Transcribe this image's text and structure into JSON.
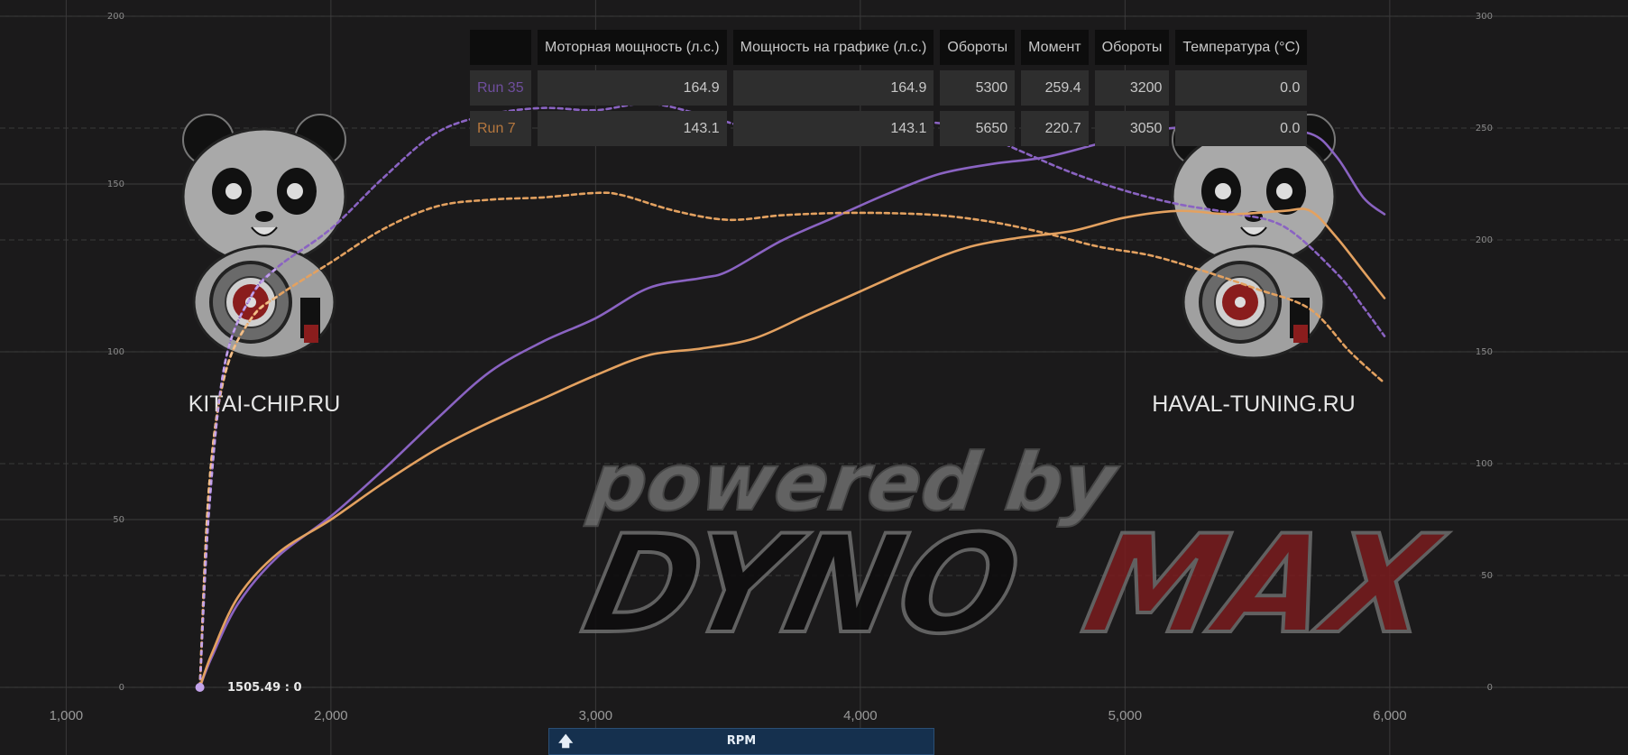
{
  "watermark": {
    "line1": "powered by",
    "line2a": "DYNO",
    "line2b": "MAX"
  },
  "logos": {
    "left_text": "KITAI-CHIP.RU",
    "right_text": "HAVAL-TUNING.RU"
  },
  "cursor_label": "1505.49 : 0",
  "rpm_button": {
    "label": "RPM",
    "icon": "arrow-up-icon"
  },
  "legend_table": {
    "headers": [
      "",
      "Моторная мощность (л.с.)",
      "Мощность на графике (л.с.)",
      "Обороты",
      "Момент",
      "Обороты",
      "Температура (°C)"
    ],
    "rows": [
      {
        "name": "Run 35",
        "color": "#6f4e9e",
        "engine_hp": "164.9",
        "graph_hp": "164.9",
        "hp_rpm": "5300",
        "torque": "259.4",
        "tq_rpm": "3200",
        "temp": "0.0"
      },
      {
        "name": "Run 7",
        "color": "#b5773e",
        "engine_hp": "143.1",
        "graph_hp": "143.1",
        "hp_rpm": "5650",
        "torque": "220.7",
        "tq_rpm": "3050",
        "temp": "0.0"
      }
    ]
  },
  "chart_data": {
    "type": "line",
    "x_axis": {
      "range": [
        750,
        6900
      ],
      "ticks": [
        1000,
        2000,
        3000,
        4000,
        5000,
        6000
      ],
      "tick_labels": [
        "1,000",
        "2,000",
        "3,000",
        "4,000",
        "5,000",
        "6,000"
      ]
    },
    "y_left": {
      "range": [
        0,
        200
      ],
      "ticks": [
        0,
        50,
        100,
        150,
        200
      ]
    },
    "y_right": {
      "range": [
        0,
        300
      ],
      "ticks": [
        0,
        50,
        100,
        150,
        200,
        250,
        300
      ]
    },
    "grid": true,
    "colors": {
      "run35": "#8a63c2",
      "run7": "#e3a160",
      "run35_pale": "#c3a3ea",
      "run7_pale": "#f2c08c"
    },
    "series": [
      {
        "name": "Run 35",
        "kind": "power",
        "axis": "left",
        "color": "#8a63c2",
        "dashed": false,
        "points": [
          [
            1505,
            0
          ],
          [
            1550,
            9
          ],
          [
            1650,
            25
          ],
          [
            1800,
            39
          ],
          [
            2000,
            51
          ],
          [
            2200,
            65
          ],
          [
            2400,
            80
          ],
          [
            2600,
            94
          ],
          [
            2800,
            103
          ],
          [
            3000,
            110
          ],
          [
            3200,
            119
          ],
          [
            3400,
            122
          ],
          [
            3500,
            124
          ],
          [
            3700,
            133
          ],
          [
            3900,
            140
          ],
          [
            4100,
            147
          ],
          [
            4300,
            153
          ],
          [
            4500,
            156
          ],
          [
            4700,
            158
          ],
          [
            4900,
            162
          ],
          [
            5100,
            166
          ],
          [
            5300,
            167
          ],
          [
            5500,
            166
          ],
          [
            5700,
            165
          ],
          [
            5800,
            158
          ],
          [
            5900,
            146
          ],
          [
            5980,
            141
          ]
        ]
      },
      {
        "name": "Run 35",
        "kind": "torque",
        "axis": "right",
        "color": "#8a63c2",
        "dashed": true,
        "points": [
          [
            1505,
            0
          ],
          [
            1540,
            80
          ],
          [
            1600,
            145
          ],
          [
            1700,
            175
          ],
          [
            1800,
            188
          ],
          [
            2000,
            205
          ],
          [
            2200,
            228
          ],
          [
            2400,
            248
          ],
          [
            2600,
            256
          ],
          [
            2800,
            259
          ],
          [
            3000,
            258
          ],
          [
            3200,
            261
          ],
          [
            3400,
            256
          ],
          [
            3600,
            250
          ],
          [
            3800,
            251
          ],
          [
            4000,
            252
          ],
          [
            4200,
            253
          ],
          [
            4400,
            250
          ],
          [
            4600,
            240
          ],
          [
            4800,
            230
          ],
          [
            5000,
            222
          ],
          [
            5200,
            216
          ],
          [
            5400,
            212
          ],
          [
            5600,
            206
          ],
          [
            5800,
            185
          ],
          [
            5900,
            170
          ],
          [
            5980,
            157
          ]
        ]
      },
      {
        "name": "Run 7",
        "kind": "power",
        "axis": "left",
        "color": "#e3a160",
        "dashed": false,
        "points": [
          [
            1505,
            0
          ],
          [
            1550,
            10
          ],
          [
            1650,
            27
          ],
          [
            1800,
            40
          ],
          [
            2000,
            50
          ],
          [
            2200,
            61
          ],
          [
            2400,
            71
          ],
          [
            2600,
            79
          ],
          [
            2800,
            86
          ],
          [
            3000,
            93
          ],
          [
            3200,
            99
          ],
          [
            3400,
            101
          ],
          [
            3600,
            104
          ],
          [
            3800,
            111
          ],
          [
            4000,
            118
          ],
          [
            4200,
            125
          ],
          [
            4400,
            131
          ],
          [
            4600,
            134
          ],
          [
            4800,
            136
          ],
          [
            5000,
            140
          ],
          [
            5200,
            142
          ],
          [
            5400,
            141
          ],
          [
            5600,
            142
          ],
          [
            5700,
            142
          ],
          [
            5800,
            134
          ],
          [
            5900,
            124
          ],
          [
            5980,
            116
          ]
        ]
      },
      {
        "name": "Run 7",
        "kind": "torque",
        "axis": "right",
        "color": "#e3a160",
        "dashed": true,
        "points": [
          [
            1505,
            0
          ],
          [
            1540,
            90
          ],
          [
            1600,
            140
          ],
          [
            1700,
            165
          ],
          [
            1800,
            175
          ],
          [
            2000,
            190
          ],
          [
            2200,
            205
          ],
          [
            2400,
            215
          ],
          [
            2600,
            218
          ],
          [
            2800,
            219
          ],
          [
            3000,
            221
          ],
          [
            3100,
            220
          ],
          [
            3300,
            213
          ],
          [
            3500,
            209
          ],
          [
            3700,
            211
          ],
          [
            3900,
            212
          ],
          [
            4100,
            212
          ],
          [
            4300,
            211
          ],
          [
            4500,
            208
          ],
          [
            4700,
            203
          ],
          [
            4900,
            197
          ],
          [
            5100,
            193
          ],
          [
            5300,
            186
          ],
          [
            5500,
            178
          ],
          [
            5700,
            169
          ],
          [
            5850,
            150
          ],
          [
            5980,
            136
          ]
        ]
      }
    ]
  }
}
